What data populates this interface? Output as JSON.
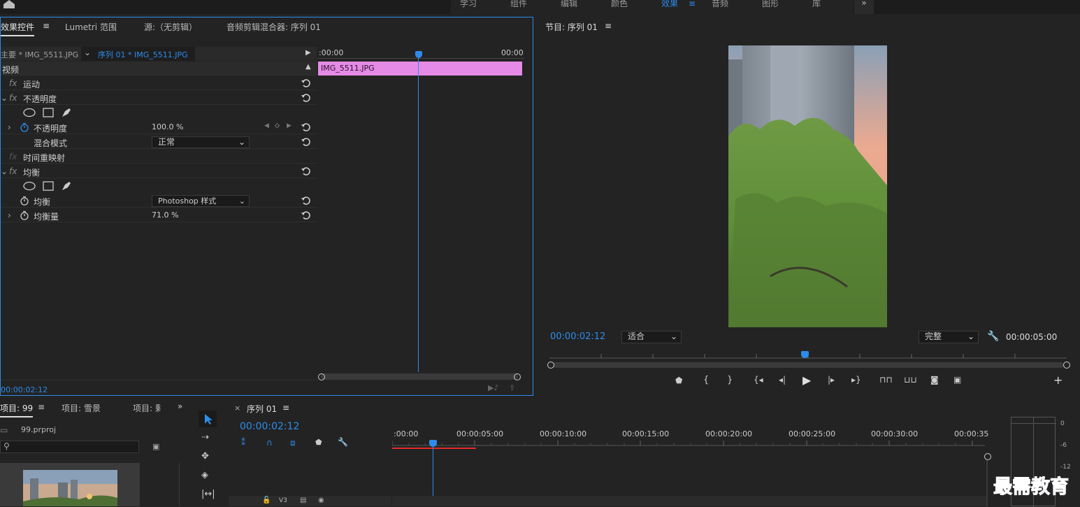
{
  "topbar": {
    "workspace_tabs": [
      "学习",
      "组件",
      "编辑",
      "颜色",
      "效果",
      "音频",
      "图形",
      "库"
    ],
    "active_tab": "效果",
    "overflow": "»"
  },
  "effect_controls": {
    "tabs": [
      "效果控件",
      "Lumetri 范围",
      "源:（无剪辑）",
      "音频剪辑混合器: 序列 01"
    ],
    "menu_icon": "≡",
    "master_label": "主要 * IMG_5511.JPG",
    "sequence_label": "序列 01 * IMG_5511.JPG",
    "timeline_start": ":00:00",
    "timeline_end": "00:00",
    "clip_name": "IMG_5511.JPG",
    "section_video": "视频",
    "rows": {
      "motion": "运动",
      "opacity": "不透明度",
      "opacity_param": "不透明度",
      "opacity_value": "100.0 %",
      "blend_mode_label": "混合模式",
      "blend_mode_value": "正常",
      "time_remap": "时间重映射",
      "equalize": "均衡",
      "equalize_param": "均衡",
      "equalize_value": "Photoshop 样式",
      "equalize_amount_label": "均衡量",
      "equalize_amount_value": "71.0 %"
    },
    "fx_label": "fx",
    "timecode": "00:00:02:12"
  },
  "program_monitor": {
    "title": "节目: 序列 01",
    "menu_icon": "≡",
    "timecode": "00:00:02:12",
    "zoom_value": "适合",
    "quality_value": "完整",
    "duration": "00:00:05:00",
    "playhead_fraction": 0.49,
    "controls": [
      "marker-icon",
      "mark-in-icon",
      "mark-out-icon",
      "go-to-in-icon",
      "step-back-icon",
      "play-icon",
      "step-forward-icon",
      "go-to-out-icon",
      "lift-icon",
      "extract-icon",
      "export-frame-icon",
      "compare-icon",
      "add-button-icon"
    ]
  },
  "project": {
    "tabs": [
      "项目: 99",
      "项目: 雪景",
      "项目: 剩"
    ],
    "menu_icon": "≡",
    "overflow": "»",
    "file_name": "99.prproj",
    "search_placeholder": ""
  },
  "timeline": {
    "close": "×",
    "title": "序列 01",
    "menu_icon": "≡",
    "timecode": "00:00:02:12",
    "ruler_labels": [
      ":00:00",
      "00:00:05:00",
      "00:00:10:00",
      "00:00:15:00",
      "00:00:20:00",
      "00:00:25:00",
      "00:00:30:00",
      "00:00:35"
    ],
    "track_label": "V3",
    "playhead_fraction": 0.072
  },
  "meter": {
    "labels": [
      "0",
      "-6",
      "-12"
    ]
  },
  "watermark": "最需教育",
  "colors": {
    "accent": "#2d8ceb",
    "clip": "#e58ae6",
    "work_area": "#e12b2b"
  }
}
